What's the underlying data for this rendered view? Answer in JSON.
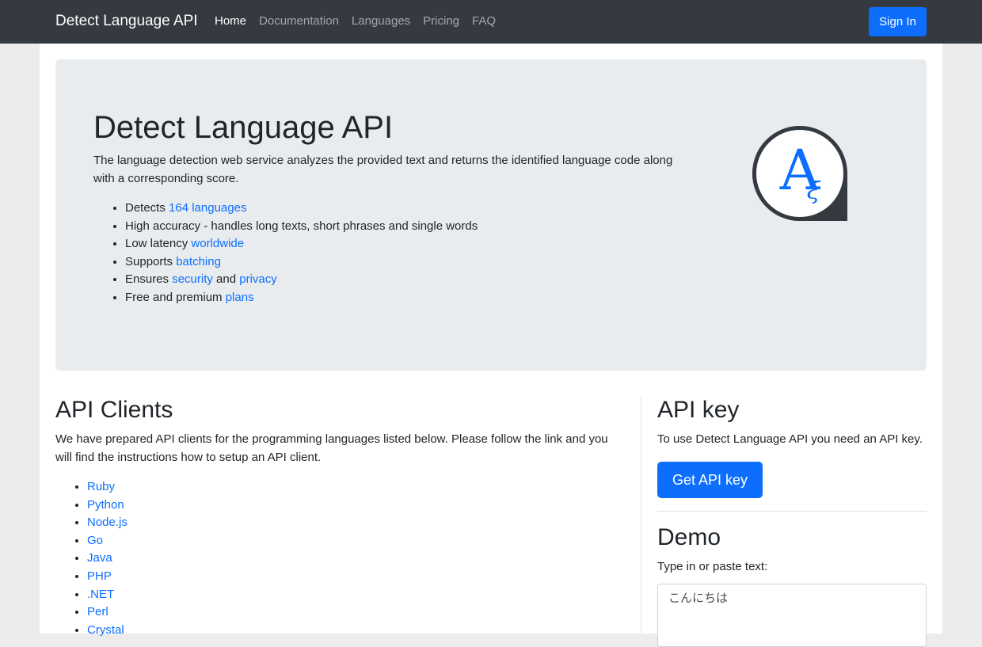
{
  "navbar": {
    "brand": "Detect Language API",
    "links": [
      "Home",
      "Documentation",
      "Languages",
      "Pricing",
      "FAQ"
    ],
    "signin_label": "Sign In"
  },
  "hero": {
    "title": "Detect Language API",
    "lead": "The language detection web service analyzes the provided text and returns the identified language code along with a corresponding score.",
    "features": [
      {
        "pre": "Detects ",
        "link": "164 languages",
        "mid": "",
        "link2": ""
      },
      {
        "pre": "High accuracy - handles long texts, short phrases and single words",
        "link": "",
        "mid": "",
        "link2": ""
      },
      {
        "pre": "Low latency ",
        "link": "worldwide",
        "mid": "",
        "link2": ""
      },
      {
        "pre": "Supports ",
        "link": "batching",
        "mid": "",
        "link2": ""
      },
      {
        "pre": "Ensures ",
        "link": "security",
        "mid": " and ",
        "link2": "privacy"
      },
      {
        "pre": "Free and premium ",
        "link": "plans",
        "mid": "",
        "link2": ""
      }
    ],
    "logo_icon": "translate-logo-icon",
    "logo_colors": {
      "ring": "#343a40",
      "letter": "#0d6efd"
    }
  },
  "clients": {
    "title": "API Clients",
    "text": "We have prepared API clients for the programming languages listed below. Please follow the link and you will find the instructions how to setup an API client.",
    "items": [
      "Ruby",
      "Python",
      "Node.js",
      "Go",
      "Java",
      "PHP",
      ".NET",
      "Perl",
      "Crystal"
    ]
  },
  "apikey": {
    "title": "API key",
    "text": "To use Detect Language API you need an API key.",
    "button_label": "Get API key"
  },
  "demo": {
    "title": "Demo",
    "label": "Type in or paste text:",
    "value": "こんにちは"
  },
  "colors": {
    "primary": "#0d6efd",
    "navbar": "#343a40",
    "jumbotron": "#e9ecef"
  }
}
